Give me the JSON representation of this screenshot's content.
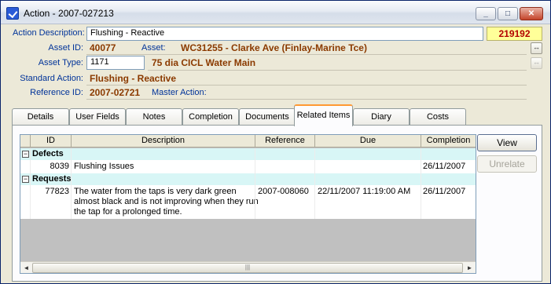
{
  "window": {
    "title": "Action - 2007-027213",
    "controls": {
      "minimize": "_",
      "maximize": "□",
      "close": "✕"
    }
  },
  "header": {
    "action_description_label": "Action Description:",
    "action_description_value": "Flushing - Reactive",
    "badge": "219192",
    "asset_id_label": "Asset ID:",
    "asset_id_value": "40077",
    "asset_label": "Asset:",
    "asset_value": "WC31255 - Clarke Ave (Finlay-Marine Tce)",
    "asset_type_label": "Asset Type:",
    "asset_type_code": "1171",
    "asset_type_desc": "75 dia CICL Water Main",
    "standard_action_label": "Standard Action:",
    "standard_action_value": "Flushing - Reactive",
    "reference_id_label": "Reference ID:",
    "reference_id_value": "2007-02721",
    "master_action_label": "Master Action:",
    "master_action_value": ""
  },
  "mini_buttons": {
    "asset_lookup": "↔",
    "asset_type_lookup": "↔"
  },
  "tabs": [
    {
      "label": "Details"
    },
    {
      "label": "User Fields"
    },
    {
      "label": "Notes"
    },
    {
      "label": "Completion"
    },
    {
      "label": "Documents"
    },
    {
      "label": "Related Items",
      "active": true
    },
    {
      "label": "Diary"
    },
    {
      "label": "Costs"
    }
  ],
  "grid": {
    "columns": [
      "ID",
      "Description",
      "Reference",
      "Due",
      "Completion"
    ],
    "groups": [
      {
        "label": "Defects",
        "toggle": "−",
        "rows": [
          {
            "id": "8039",
            "description": "Flushing Issues",
            "reference": "",
            "due": "",
            "completion": "26/11/2007"
          }
        ]
      },
      {
        "label": "Requests",
        "toggle": "−",
        "rows": [
          {
            "id": "77823",
            "description_lines": [
              "The water from the taps is very dark green",
              "almost black and is not improving when they run",
              "the tap for a prolonged time."
            ],
            "reference": "2007-008060",
            "due": "22/11/2007 11:19:00 AM",
            "completion": "26/11/2007"
          }
        ]
      }
    ],
    "scrollbar": {
      "left_arrow": "◄",
      "right_arrow": "►",
      "thumb_grip": "|||"
    }
  },
  "side_buttons": {
    "view": "View",
    "unrelate": "Unrelate"
  },
  "colors": {
    "accent": "#003399",
    "value_text": "#8b3a00",
    "group_row": "#d8f6f6",
    "badge_bg": "#ffff99"
  }
}
